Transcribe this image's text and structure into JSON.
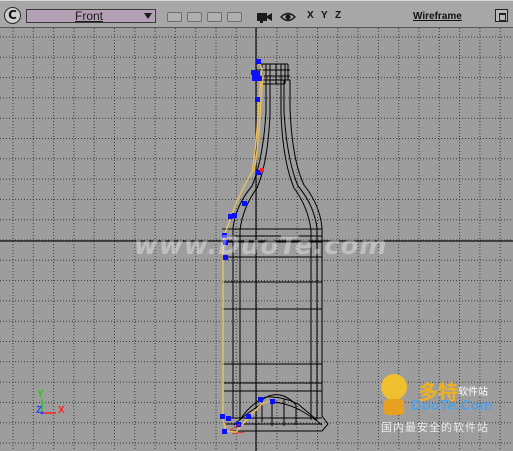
{
  "toolbar": {
    "menu_glyph": "C",
    "view_name": "Front",
    "display_mode": "Wireframe",
    "axis_buttons": [
      "X",
      "Y",
      "Z"
    ],
    "icons": {
      "menu": "viewport-menu-icon",
      "dropdown": "chevron-down-icon",
      "camera": "camera-icon",
      "visibility": "eye-icon",
      "maximize": "maximize-icon"
    }
  },
  "watermark_text": "www.DuoTe.com",
  "logo": {
    "brand": "多特",
    "sub": "软件站",
    "url": "DuoTe.Com",
    "slogan": "国内最安全的软件站"
  },
  "axis_gizmo": {
    "x": "X",
    "y": "Y",
    "z": "Z"
  },
  "colors": {
    "toolbar_bg": "#a7a7a7",
    "view_select_bg": "#b4a0b4",
    "viewport_bg": "#9d9d9d",
    "grid_line": "#3a3a3a",
    "wireframe": "#000000",
    "selected_curve": "#e8c060",
    "control_point": "#0a10ff",
    "selected_point": "#ff2020",
    "axis_x": "#ff2020",
    "axis_y": "#18d018",
    "axis_z": "#3040ff"
  }
}
